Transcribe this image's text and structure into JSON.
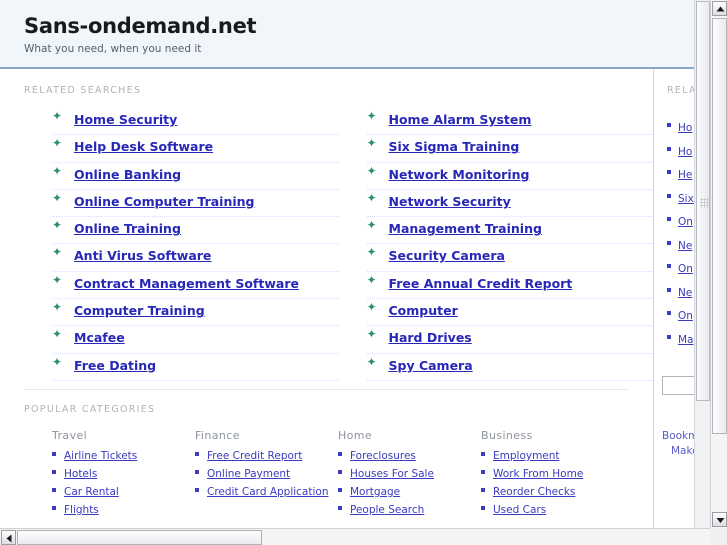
{
  "header": {
    "title": "Sans-ondemand.net",
    "tagline": "What you need, when you need it"
  },
  "main": {
    "related_label": "RELATED SEARCHES",
    "popular_label": "POPULAR CATEGORIES",
    "related_searches_left": [
      "Home Security",
      "Help Desk Software",
      "Online Banking",
      "Online Computer Training",
      "Online Training",
      "Anti Virus Software",
      "Contract Management Software",
      "Computer Training",
      "Mcafee",
      "Free Dating"
    ],
    "related_searches_right": [
      "Home Alarm System",
      "Six Sigma Training",
      "Network Monitoring",
      "Network Security",
      "Management Training",
      "Security Camera",
      "Free Annual Credit Report",
      "Computer",
      "Hard Drives",
      "Spy Camera"
    ],
    "categories": [
      {
        "heading": "Travel",
        "items": [
          "Airline Tickets",
          "Hotels",
          "Car Rental",
          "Flights"
        ]
      },
      {
        "heading": "Finance",
        "items": [
          "Free Credit Report",
          "Online Payment",
          "Credit Card Application"
        ]
      },
      {
        "heading": "Home",
        "items": [
          "Foreclosures",
          "Houses For Sale",
          "Mortgage",
          "People Search"
        ]
      },
      {
        "heading": "Business",
        "items": [
          "Employment",
          "Work From Home",
          "Reorder Checks",
          "Used Cars"
        ]
      }
    ]
  },
  "sidebar": {
    "related_label": "RELATED",
    "links": [
      "Ho",
      "Ho",
      "He",
      "Six",
      "On",
      "Ne",
      "On",
      "Ne",
      "On",
      "Ma"
    ],
    "search_value": "",
    "search_placeholder": "",
    "footer_line_1": "Bookmark",
    "footer_line_2": "Make this"
  },
  "icons": {
    "arrow_bullet": "✦",
    "scroll_up": "▲",
    "scroll_down": "▼",
    "scroll_left": "◄",
    "scroll_right": "►"
  },
  "colors": {
    "header_bg": "#f0f6fa",
    "header_rule": "#8ba4cc",
    "link": "#2727b8",
    "cat_link": "#3b3bbe",
    "bullet_arrow": "#2f8f72",
    "label": "#aeb4ba",
    "divider": "#c9d2ee"
  }
}
